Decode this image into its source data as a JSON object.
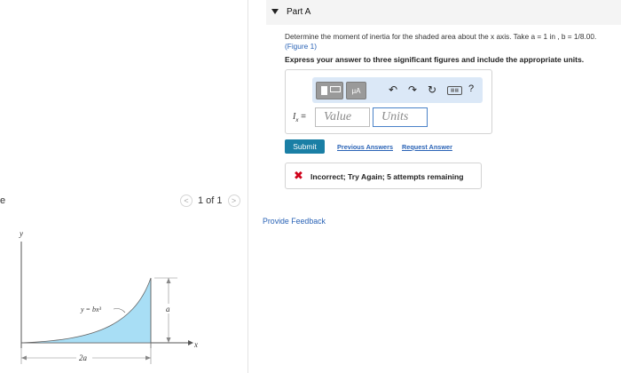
{
  "left": {
    "figure_label_cut": "e",
    "pager_prev": "<",
    "pager_text": "1 of 1",
    "pager_next": ">",
    "figure": {
      "y_axis": "y",
      "x_axis": "x",
      "curve_label": "y = bx³",
      "height_label": "a",
      "width_label": "2a"
    }
  },
  "part": {
    "title": "Part A"
  },
  "problem": {
    "text": "Determine the moment of inertia for the shaded area about the x axis. Take a = 1 in , b = 1/8.00.",
    "figure_link": "(Figure 1)",
    "instruction": "Express your answer to three significant figures and include the appropriate units."
  },
  "answer": {
    "toolbar_mu": "μA",
    "undo": "↶",
    "redo": "↷",
    "reset": "↻",
    "keyboard": "▦▦",
    "help": "?",
    "label_var": "I",
    "label_sub": "x",
    "label_eq": " =",
    "value_placeholder": "Value",
    "units_placeholder": "Units"
  },
  "actions": {
    "submit": "Submit",
    "previous_answers": "Previous Answers",
    "request_answer": "Request Answer"
  },
  "feedback": {
    "icon": "✖",
    "message": "Incorrect; Try Again; 5 attempts remaining"
  },
  "provide_feedback": "Provide Feedback",
  "colors": {
    "accent": "#1a7fa5",
    "link": "#2a63b6",
    "error": "#d0021b",
    "shade": "#a8def5",
    "toolbar_bg": "#dbe8f7"
  }
}
